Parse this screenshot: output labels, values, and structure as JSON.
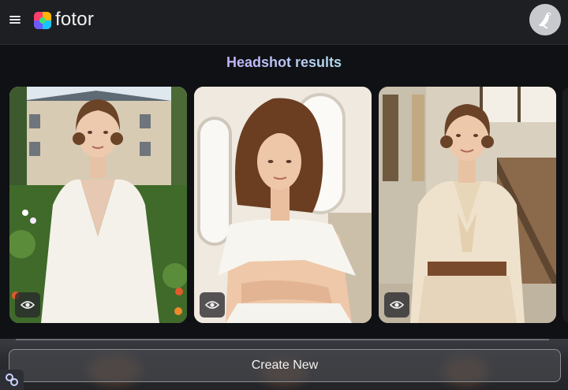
{
  "header": {
    "menu_icon": "hamburger-icon",
    "logo_text": "fotor",
    "avatar_icon": "bird-avatar-icon"
  },
  "main": {
    "title": "Headshot results",
    "cards": [
      {
        "preview_icon": "eye-icon"
      },
      {
        "preview_icon": "eye-icon"
      },
      {
        "preview_icon": "eye-icon"
      }
    ]
  },
  "footer": {
    "create_button_label": "Create New",
    "badge_icon": "link-icon"
  },
  "colors": {
    "header_bg": "#1e1f23",
    "page_bg": "#101114",
    "title_gradient_start": "#8fd3ff",
    "title_gradient_mid": "#c6a8ff"
  }
}
